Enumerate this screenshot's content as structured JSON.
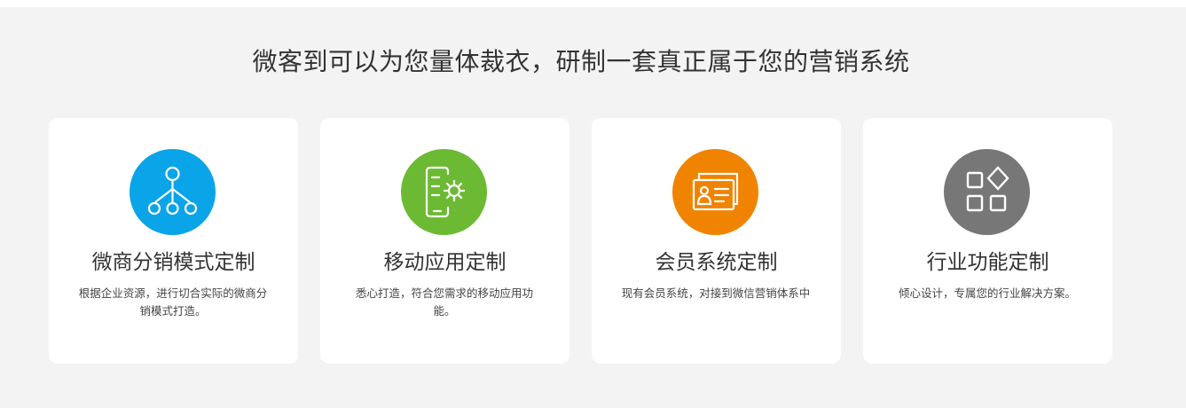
{
  "headline": "微客到可以为您量体裁衣，研制一套真正属于您的营销系统",
  "cards": [
    {
      "title": "微商分销模式定制",
      "description": "根据企业资源，进行切合实际的微商分销模式打造。",
      "icon": "hierarchy-tree-icon",
      "color": "#0aa4e8"
    },
    {
      "title": "移动应用定制",
      "description": "悉心打造，符合您需求的移动应用功能。",
      "icon": "mobile-settings-icon",
      "color": "#6cba33"
    },
    {
      "title": "会员系统定制",
      "description": "现有会员系统，对接到微信营销体系中",
      "icon": "member-card-icon",
      "color": "#f08300"
    },
    {
      "title": "行业功能定制",
      "description": "倾心设计，专属您的行业解决方案。",
      "icon": "app-grid-icon",
      "color": "#777777"
    }
  ]
}
